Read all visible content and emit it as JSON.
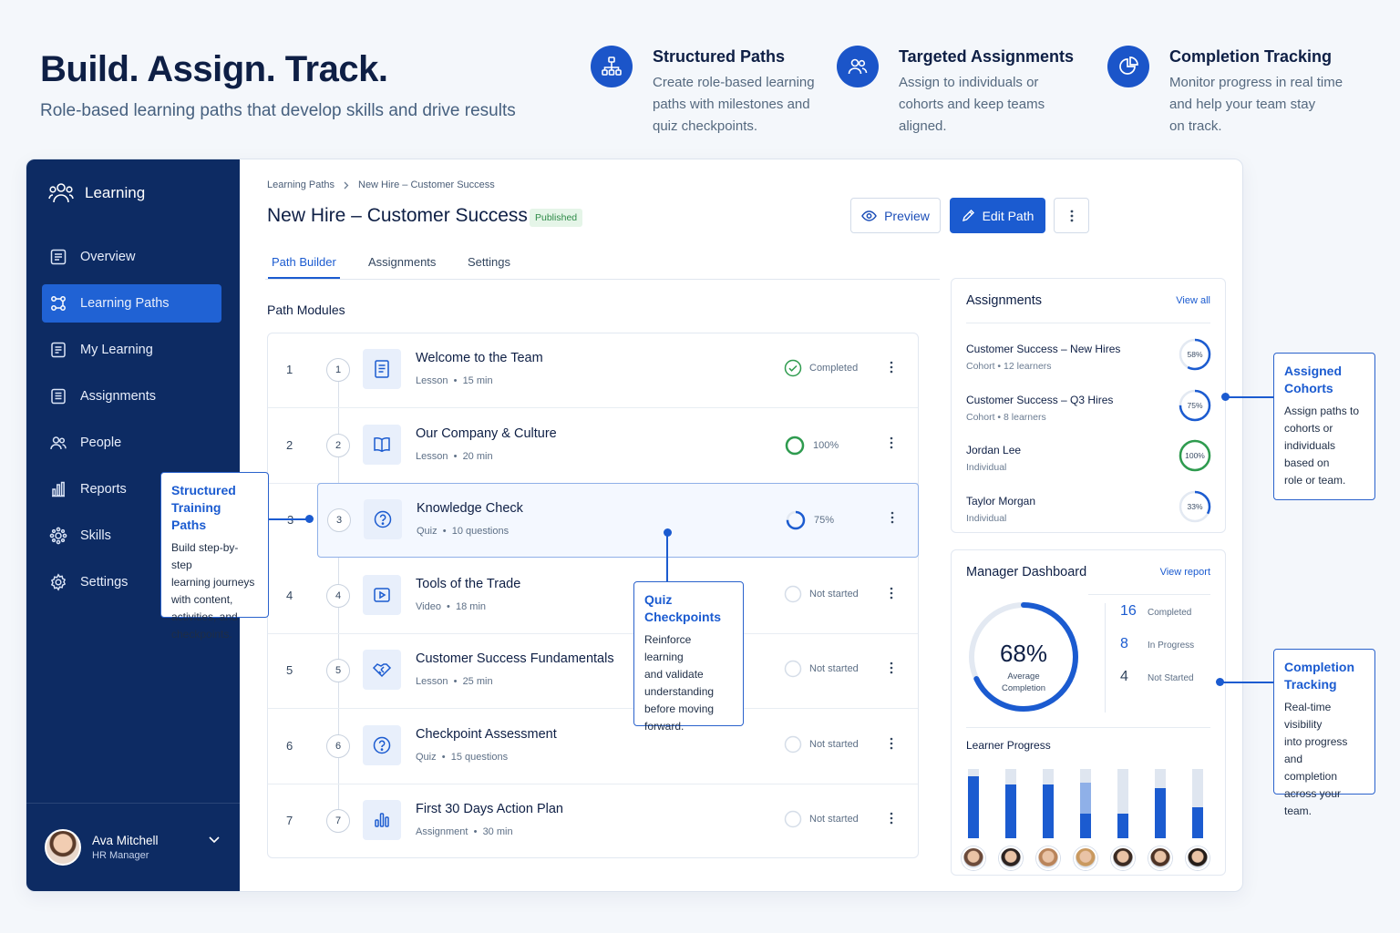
{
  "hero": {
    "title": "Build. Assign. Track.",
    "subtitle": "Role-based learning paths that develop skills and drive results"
  },
  "features": [
    {
      "icon": "hierarchy-icon",
      "title": "Structured Paths",
      "description": "Create role-based learning\npaths with milestones and\nquiz checkpoints."
    },
    {
      "icon": "users-icon",
      "title": "Targeted Assignments",
      "description": "Assign to individuals or\ncohorts and keep teams\naligned."
    },
    {
      "icon": "pie-chart-icon",
      "title": "Completion Tracking",
      "description": "Monitor progress in real time\nand help your team stay\non track."
    }
  ],
  "sidebar": {
    "brand": "Learning",
    "items": [
      {
        "label": "Overview",
        "icon": "overview-icon",
        "active": false
      },
      {
        "label": "Learning Paths",
        "icon": "learning-paths-icon",
        "active": true
      },
      {
        "label": "My Learning",
        "icon": "my-learning-icon",
        "active": false
      },
      {
        "label": "Assignments",
        "icon": "assignments-icon",
        "active": false
      },
      {
        "label": "People",
        "icon": "people-icon",
        "active": false
      },
      {
        "label": "Reports",
        "icon": "reports-icon",
        "active": false
      },
      {
        "label": "Skills",
        "icon": "skills-icon",
        "active": false
      },
      {
        "label": "Settings",
        "icon": "settings-icon",
        "active": false
      }
    ],
    "user": {
      "name": "Ava Mitchell",
      "role": "HR Manager"
    }
  },
  "breadcrumb": [
    "Learning Paths",
    "New Hire – Customer Success"
  ],
  "page": {
    "title": "New Hire – Customer Success",
    "status": "Published",
    "preview_label": "Preview",
    "edit_label": "Edit Path"
  },
  "tabs": [
    "Path Builder",
    "Assignments",
    "Settings"
  ],
  "modules_label": "Path Modules",
  "modules": [
    {
      "num": "1",
      "title": "Welcome to the Team",
      "type": "Lesson",
      "detail": "15 min",
      "status": "Completed",
      "progress": 100,
      "icon": "document-icon"
    },
    {
      "num": "2",
      "title": "Our Company & Culture",
      "type": "Lesson",
      "detail": "20 min",
      "status": "100%",
      "progress": 100,
      "icon": "book-icon"
    },
    {
      "num": "3",
      "title": "Knowledge Check",
      "type": "Quiz",
      "detail": "10 questions",
      "status": "75%",
      "progress": 75,
      "icon": "question-icon"
    },
    {
      "num": "4",
      "title": "Tools of the Trade",
      "type": "Video",
      "detail": "18 min",
      "status": "Not started",
      "progress": 0,
      "icon": "video-icon"
    },
    {
      "num": "5",
      "title": "Customer Success Fundamentals",
      "type": "Lesson",
      "detail": "25 min",
      "status": "Not started",
      "progress": 0,
      "icon": "handshake-icon"
    },
    {
      "num": "6",
      "title": "Checkpoint Assessment",
      "type": "Quiz",
      "detail": "15 questions",
      "status": "Not started",
      "progress": 0,
      "icon": "question-icon"
    },
    {
      "num": "7",
      "title": "First 30 Days Action Plan",
      "type": "Assignment",
      "detail": "30 min",
      "status": "Not started",
      "progress": 0,
      "icon": "chart-icon"
    }
  ],
  "assignments": {
    "title": "Assignments",
    "link": "View all",
    "rows": [
      {
        "name": "Customer Success – New Hires",
        "kind": "Cohort",
        "learners": "12 learners",
        "percent": 58,
        "label": "58%"
      },
      {
        "name": "Customer Success – Q3 Hires",
        "kind": "Cohort",
        "learners": "8 learners",
        "percent": 75,
        "label": "75%"
      },
      {
        "name": "Jordan Lee",
        "kind": "Individual",
        "learners": "",
        "percent": 100,
        "label": "100%"
      },
      {
        "name": "Taylor Morgan",
        "kind": "Individual",
        "learners": "",
        "percent": 33,
        "label": "33%"
      }
    ]
  },
  "manager": {
    "title": "Manager Dashboard",
    "link": "View report",
    "average": "68%",
    "average_value": 68,
    "average_label": "Average\nCompletion",
    "stats": [
      {
        "value": "16",
        "label": "Completed"
      },
      {
        "value": "8",
        "label": "In Progress"
      },
      {
        "value": "4",
        "label": "Not Started"
      }
    ],
    "learner_progress_title": "Learner Progress",
    "learner_progress": [
      {
        "completed": 0.9,
        "in_progress": 0
      },
      {
        "completed": 0.78,
        "in_progress": 0
      },
      {
        "completed": 0.78,
        "in_progress": 0
      },
      {
        "completed": 0.35,
        "in_progress": 0.45
      },
      {
        "completed": 0.35,
        "in_progress": 0
      },
      {
        "completed": 0.72,
        "in_progress": 0
      },
      {
        "completed": 0.45,
        "in_progress": 0
      }
    ]
  },
  "callouts": {
    "structured": {
      "title": "Structured\nTraining Paths",
      "description": "Build step-by-step\nlearning journeys\nwith content,\nactivities, and\ncheckpoints."
    },
    "quiz": {
      "title": "Quiz\nCheckpoints",
      "description": "Reinforce learning\nand validate\nunderstanding\nbefore moving\nforward."
    },
    "cohorts": {
      "title": "Assigned\nCohorts",
      "description": "Assign paths to\ncohorts or\nindividuals\nbased on\nrole or team."
    },
    "tracking": {
      "title": "Completion\nTracking",
      "description": "Real-time visibility\ninto progress and\ncompletion\nacross your\nteam."
    }
  },
  "colors": {
    "brand": "#1b5bd0",
    "sidebar": "#0d2b63",
    "success": "#2e9b4e"
  }
}
